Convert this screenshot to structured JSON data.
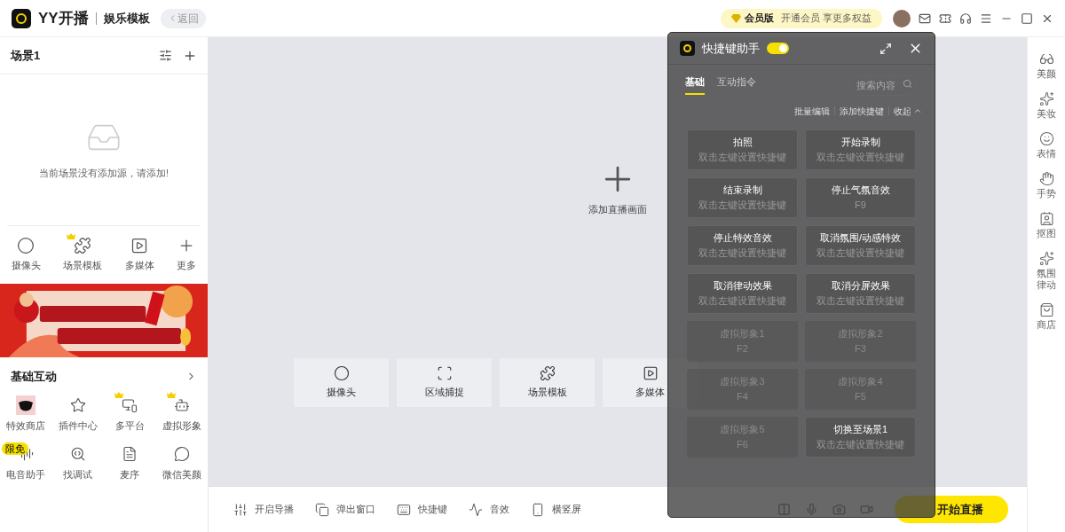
{
  "topbar": {
    "app_name": "YY开播",
    "template": "娱乐模板",
    "back": "返回",
    "vip_label": "会员版",
    "vip_promo": "开通会员 享更多权益"
  },
  "scene": {
    "title": "场景1",
    "empty_text": "当前场景没有添加源，请添加!"
  },
  "source_tools": [
    {
      "label": "摄像头",
      "vip": false
    },
    {
      "label": "场景模板",
      "vip": true
    },
    {
      "label": "多媒体",
      "vip": false
    },
    {
      "label": "更多",
      "vip": false
    }
  ],
  "interaction": {
    "title": "基础互动",
    "items": [
      {
        "label": "特效商店",
        "vip": false
      },
      {
        "label": "插件中心",
        "vip": false
      },
      {
        "label": "多平台",
        "vip": true
      },
      {
        "label": "虚拟形象",
        "vip": true
      },
      {
        "label": "电音助手",
        "vip": false,
        "badge": "限免"
      },
      {
        "label": "找调试",
        "vip": false
      },
      {
        "label": "麦序",
        "vip": false
      },
      {
        "label": "微信美颜",
        "vip": false
      }
    ]
  },
  "canvas": {
    "add_label": "添加直播画面",
    "tiles": [
      {
        "label": "摄像头"
      },
      {
        "label": "区域捕捉"
      },
      {
        "label": "场景模板"
      },
      {
        "label": "多媒体"
      }
    ]
  },
  "bottom_bar": {
    "items": [
      {
        "label": "开启导播"
      },
      {
        "label": "弹出窗口"
      },
      {
        "label": "快捷键"
      },
      {
        "label": "音效"
      },
      {
        "label": "横竖屏"
      }
    ],
    "start": "开始直播"
  },
  "right_bar": [
    {
      "label": "美颜"
    },
    {
      "label": "美妆"
    },
    {
      "label": "表情"
    },
    {
      "label": "手势"
    },
    {
      "label": "抠图"
    },
    {
      "label": "氛围律动"
    },
    {
      "label": "商店"
    }
  ],
  "shortcut_panel": {
    "title": "快捷键助手",
    "enabled": true,
    "tabs": [
      {
        "label": "基础",
        "selected": true
      },
      {
        "label": "互动指令",
        "selected": false
      }
    ],
    "search": {
      "placeholder": "搜索内容"
    },
    "actions": [
      "批量编辑",
      "添加快捷键",
      "收起"
    ],
    "shortcuts": [
      {
        "name": "拍照",
        "key": "双击左键设置快捷键",
        "disabled": false
      },
      {
        "name": "开始录制",
        "key": "双击左键设置快捷键",
        "disabled": false
      },
      {
        "name": "结束录制",
        "key": "双击左键设置快捷键",
        "disabled": false
      },
      {
        "name": "停止气氛音效",
        "key": "F9",
        "disabled": false
      },
      {
        "name": "停止特效音效",
        "key": "双击左键设置快捷键",
        "disabled": false
      },
      {
        "name": "取消氛围/动感特效",
        "key": "双击左键设置快捷键",
        "disabled": false
      },
      {
        "name": "取消律动效果",
        "key": "双击左键设置快捷键",
        "disabled": false
      },
      {
        "name": "取消分屏效果",
        "key": "双击左键设置快捷键",
        "disabled": false
      },
      {
        "name": "虚拟形象1",
        "key": "F2",
        "disabled": true
      },
      {
        "name": "虚拟形象2",
        "key": "F3",
        "disabled": true
      },
      {
        "name": "虚拟形象3",
        "key": "F4",
        "disabled": true
      },
      {
        "name": "虚拟形象4",
        "key": "F5",
        "disabled": true
      },
      {
        "name": "虚拟形象5",
        "key": "F6",
        "disabled": true
      },
      {
        "name": "切换至场景1",
        "key": "双击左键设置快捷键",
        "disabled": false
      }
    ]
  }
}
